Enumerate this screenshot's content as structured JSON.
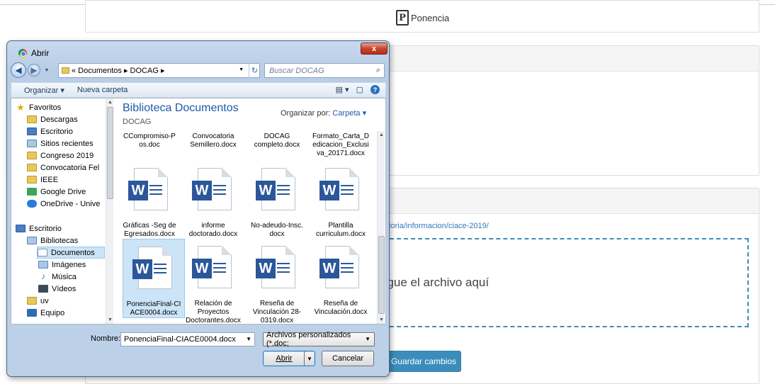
{
  "page": {
    "ponencia_label": "Ponencia",
    "link_text": "ditoria/informacion/ciace-2019/",
    "drop_text": "egue el archivo aquí",
    "save_button": "Guardar cambios"
  },
  "dialog": {
    "title": "Abrir",
    "close_label": "x",
    "breadcrumb": "« Documentos ▸ DOCAG ▸",
    "search_placeholder": "Buscar DOCAG",
    "toolbar": {
      "organize": "Organizar ▾",
      "new_folder": "Nueva carpeta"
    },
    "tree": [
      {
        "label": "Favoritos",
        "icon": "star-icon"
      },
      {
        "label": "Descargas",
        "icon": "folder-icon"
      },
      {
        "label": "Escritorio",
        "icon": "desktop-icon"
      },
      {
        "label": "Sitios recientes",
        "icon": "recent-icon"
      },
      {
        "label": "Congreso 2019",
        "icon": "folder-icon"
      },
      {
        "label": "Convocatoria Fel",
        "icon": "folder-icon"
      },
      {
        "label": "IEEE",
        "icon": "folder-icon"
      },
      {
        "label": "Google Drive",
        "icon": "google-drive-icon"
      },
      {
        "label": "OneDrive - Unive",
        "icon": "onedrive-icon"
      },
      {
        "label": "Escritorio",
        "icon": "desktop-icon"
      },
      {
        "label": "Bibliotecas",
        "icon": "library-icon"
      },
      {
        "label": "Documentos",
        "icon": "document-icon"
      },
      {
        "label": "Imágenes",
        "icon": "images-icon"
      },
      {
        "label": "Música",
        "icon": "music-icon"
      },
      {
        "label": "Vídeos",
        "icon": "video-icon"
      },
      {
        "label": "uv",
        "icon": "folder-icon"
      },
      {
        "label": "Equipo",
        "icon": "computer-icon"
      }
    ],
    "library_title": "Biblioteca Documentos",
    "library_sub": "DOCAG",
    "organize_by_label": "Organizar por:",
    "organize_by_value": "Carpeta ▾",
    "files_top": [
      "CCompromiso-P os.doc",
      "Convocatoria Semillero.docx",
      "DOCAG completo.docx",
      "Formato_Carta_D edicacion_Exclusi va_20171.docx"
    ],
    "files_mid": [
      "Gráficas -Seg de Egresados.docx",
      "informe doctorado.docx",
      "No-adeudo-Insc. docx",
      "Plantilla curriculum.docx"
    ],
    "files_bottom": [
      "PonenciaFinal-CI ACE0004.docx",
      "Relación de Proyectos Doctorantes.docx",
      "Reseña de Vinculación 28-0319.docx",
      "Reseña de Vinculación.docx"
    ],
    "filename_label": "Nombre:",
    "filename_value": "PonenciaFinal-CIACE0004.docx",
    "filetype_value": "Archivos personalizados (*.doc;",
    "open_button": "Abrir",
    "cancel_button": "Cancelar"
  }
}
